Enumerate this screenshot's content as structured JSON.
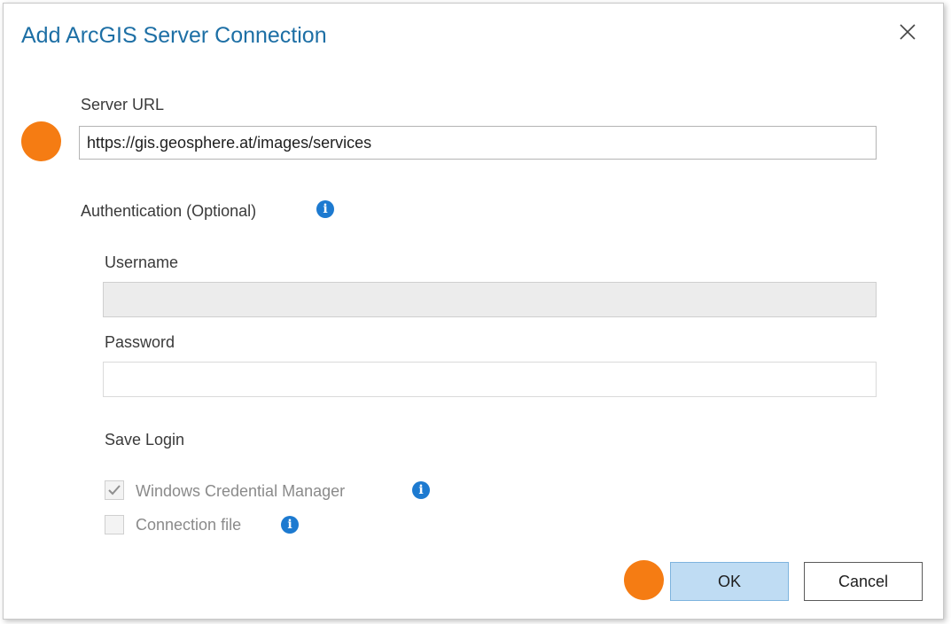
{
  "dialog": {
    "title": "Add ArcGIS Server Connection",
    "close_icon": "close-icon"
  },
  "server_url": {
    "label": "Server URL",
    "value": "https://gis.geosphere.at/images/services"
  },
  "authentication": {
    "label": "Authentication (Optional)",
    "info_icon": "info-icon",
    "username_label": "Username",
    "username_value": "",
    "password_label": "Password",
    "password_value": ""
  },
  "save_login": {
    "label": "Save Login",
    "options": [
      {
        "label": "Windows Credential Manager",
        "checked": true,
        "enabled": false
      },
      {
        "label": "Connection file",
        "checked": false,
        "enabled": false
      }
    ]
  },
  "buttons": {
    "ok_label": "OK",
    "cancel_label": "Cancel"
  },
  "colors": {
    "title": "#1d6fa5",
    "marker": "#f57c13",
    "info_icon": "#1d7ad0",
    "ok_button": "#bfdcf3"
  }
}
